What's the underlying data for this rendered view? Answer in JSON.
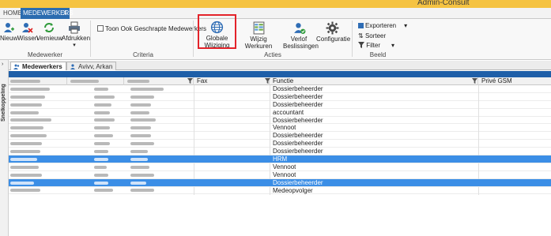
{
  "window": {
    "title": "Admin-Consult"
  },
  "ribbon_tabs": {
    "home": "HOME",
    "active": "MEDEWERKERS",
    "close_glyph": "X"
  },
  "groups": {
    "medewerker": {
      "label": "Medewerker",
      "buttons": [
        "Nieuw",
        "Wissen",
        "Vernieuw",
        "Afdrukken"
      ]
    },
    "criteria": {
      "label": "Criteria",
      "checkbox_label": "Toon Ook Geschrapte Medewerkers",
      "checkbox_checked": false
    },
    "acties": {
      "label": "Acties",
      "globale_line1": "Globale",
      "globale_line2": "Wijziging",
      "wijzig_werkuren": "Wijzig Werkuren",
      "verlof_line1": "Verlof",
      "verlof_line2": "Beslissingen",
      "configuratie": "Configuratie"
    },
    "beeld": {
      "label": "Beeld",
      "exporteren": "Exporteren",
      "sorteer": "Sorteer",
      "filter": "Filter"
    }
  },
  "side_panel": {
    "label": "Snelkoppeling"
  },
  "doc_tabs": {
    "tab1": "Medewerkers",
    "tab2": "Avivv, Arkan"
  },
  "grid": {
    "columns": {
      "fax": "Fax",
      "functie": "Functie",
      "prive_gsm": "Privé GSM"
    },
    "rows": [
      {
        "functie": "Dossierbeheerder",
        "selected": false
      },
      {
        "functie": "Dossierbeheerder",
        "selected": false
      },
      {
        "functie": "Dossierbeheerder",
        "selected": false
      },
      {
        "functie": "accountant",
        "selected": false
      },
      {
        "functie": "Dossierbeheerder",
        "selected": false
      },
      {
        "functie": "Vennoot",
        "selected": false
      },
      {
        "functie": "Dossierbeheerder",
        "selected": false
      },
      {
        "functie": "Dossierbeheerder",
        "selected": false
      },
      {
        "functie": "Dossierbeheerder",
        "selected": false
      },
      {
        "functie": "HRM",
        "selected": true
      },
      {
        "functie": "Vennoot",
        "selected": false
      },
      {
        "functie": "Vennoot",
        "selected": false
      },
      {
        "functie": "Dossierbeheerder",
        "selected": true
      },
      {
        "functie": "Medeopvolger",
        "selected": false
      }
    ]
  },
  "colors": {
    "accent": "#2b6cb0",
    "selection": "#3b8ee6",
    "highlight_border": "#e3232a",
    "title_bar": "#f5c342"
  }
}
